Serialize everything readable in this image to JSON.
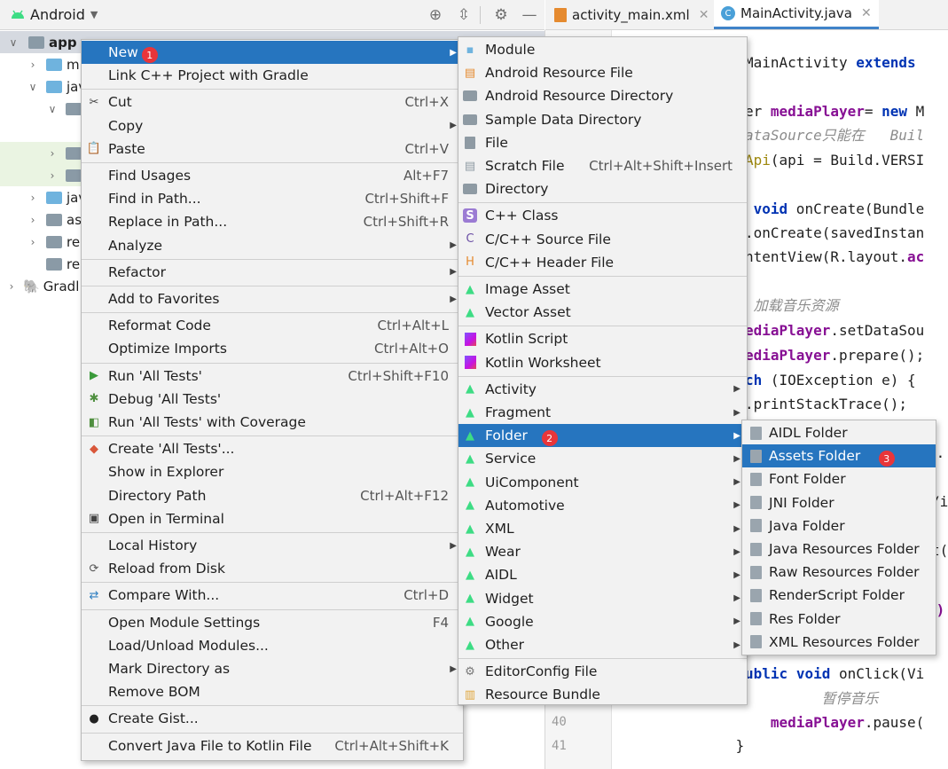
{
  "project_panel": {
    "view_selector": "Android",
    "tree": [
      {
        "label": "app",
        "expanded": true,
        "selected": true
      },
      {
        "label": "m"
      },
      {
        "label": "jav",
        "expanded": true
      },
      {
        "label": ""
      },
      {
        "label": ""
      },
      {
        "label": ""
      },
      {
        "label": "jav"
      },
      {
        "label": "as"
      },
      {
        "label": "re"
      },
      {
        "label": "re"
      },
      {
        "label": "Gradl"
      }
    ]
  },
  "editor": {
    "tabs": [
      {
        "label": "activity_main.xml",
        "active": false
      },
      {
        "label": "MainActivity.java",
        "active": true
      }
    ],
    "line_numbers": [
      "40",
      "41"
    ],
    "code_lines": [
      {
        "parts": [
          {
            "t": "MainActivity ",
            "c": ""
          },
          {
            "t": "extends",
            "c": "kw"
          }
        ]
      },
      {
        "parts": [
          {
            "t": "er ",
            "c": ""
          },
          {
            "t": "mediaPlayer",
            "c": "fld"
          },
          {
            "t": "= ",
            "c": ""
          },
          {
            "t": "new",
            "c": "kw"
          },
          {
            "t": " M",
            "c": ""
          }
        ]
      },
      {
        "parts": [
          {
            "t": "ataSource只能在   Buil",
            "c": "cm"
          }
        ]
      },
      {
        "parts": [
          {
            "t": "Api",
            "c": "ann"
          },
          {
            "t": "(api = Build.VERSI",
            "c": ""
          }
        ]
      },
      {
        "parts": [
          {
            "t": " void",
            "c": "kw"
          },
          {
            "t": " onCreate(Bundle",
            "c": ""
          }
        ]
      },
      {
        "parts": [
          {
            "t": ".onCreate(savedInstan",
            "c": ""
          }
        ]
      },
      {
        "parts": [
          {
            "t": "ntentView(R.layout.",
            "c": ""
          },
          {
            "t": "ac",
            "c": "fld"
          }
        ]
      },
      {
        "parts": [
          {
            "t": " 加载音乐资源",
            "c": "cm"
          }
        ]
      },
      {
        "parts": [
          {
            "t": "ediaPlayer",
            "c": "fld"
          },
          {
            "t": ".setDataSou",
            "c": ""
          }
        ]
      },
      {
        "parts": [
          {
            "t": "ediaPlayer",
            "c": "fld"
          },
          {
            "t": ".prepare();",
            "c": ""
          }
        ]
      },
      {
        "parts": [
          {
            "t": "ch",
            "c": "kw"
          },
          {
            "t": " (IOException e) {",
            "c": ""
          }
        ]
      },
      {
        "parts": [
          {
            "t": ".printStackTrace();",
            "c": ""
          }
        ]
      },
      {
        "parts": [
          {
            "t": ").",
            "c": ""
          }
        ]
      },
      {
        "parts": [
          {
            "t": "/i",
            "c": ""
          }
        ]
      },
      {
        "parts": [
          {
            "t": "t(",
            "c": ""
          }
        ]
      },
      {
        "parts": [
          {
            "t": "2)",
            "c": "fld"
          }
        ]
      },
      {
        "parts": [
          {
            "t": "ublic",
            "c": "kw"
          },
          {
            "t": " ",
            "c": ""
          },
          {
            "t": "void",
            "c": "kw"
          },
          {
            "t": " onClick(Vi",
            "c": ""
          }
        ]
      },
      {
        "parts": [
          {
            "t": "    暂停音乐",
            "c": "cm"
          }
        ]
      },
      {
        "parts": [
          {
            "t": "   ",
            "c": ""
          },
          {
            "t": "mediaPlayer",
            "c": "fld"
          },
          {
            "t": ".pause(",
            "c": ""
          }
        ]
      },
      {
        "parts": [
          {
            "t": " }",
            "c": ""
          }
        ]
      }
    ]
  },
  "context_menu": {
    "items": [
      {
        "label": "New",
        "submenu": true,
        "highlighted": true,
        "badge": "1"
      },
      {
        "label": "Link C++ Project with Gradle"
      },
      {
        "sep": true
      },
      {
        "label": "Cut",
        "shortcut": "Ctrl+X",
        "icon": "scissors-icon"
      },
      {
        "label": "Copy",
        "submenu": true
      },
      {
        "label": "Paste",
        "shortcut": "Ctrl+V",
        "icon": "clipboard-icon"
      },
      {
        "sep": true
      },
      {
        "label": "Find Usages",
        "shortcut": "Alt+F7"
      },
      {
        "label": "Find in Path...",
        "shortcut": "Ctrl+Shift+F"
      },
      {
        "label": "Replace in Path...",
        "shortcut": "Ctrl+Shift+R"
      },
      {
        "label": "Analyze",
        "submenu": true
      },
      {
        "sep": true
      },
      {
        "label": "Refactor",
        "submenu": true
      },
      {
        "sep": true
      },
      {
        "label": "Add to Favorites",
        "submenu": true
      },
      {
        "sep": true
      },
      {
        "label": "Reformat Code",
        "shortcut": "Ctrl+Alt+L"
      },
      {
        "label": "Optimize Imports",
        "shortcut": "Ctrl+Alt+O"
      },
      {
        "sep": true
      },
      {
        "label": "Run 'All Tests'",
        "shortcut": "Ctrl+Shift+F10",
        "icon": "run-icon"
      },
      {
        "label": "Debug 'All Tests'",
        "icon": "debug-icon"
      },
      {
        "label": "Run 'All Tests' with Coverage",
        "icon": "coverage-icon"
      },
      {
        "sep": true
      },
      {
        "label": "Create 'All Tests'...",
        "icon": "create-test-icon"
      },
      {
        "label": "Show in Explorer"
      },
      {
        "label": "Directory Path",
        "shortcut": "Ctrl+Alt+F12"
      },
      {
        "label": "Open in Terminal",
        "icon": "terminal-icon"
      },
      {
        "sep": true
      },
      {
        "label": "Local History",
        "submenu": true
      },
      {
        "label": "Reload from Disk",
        "icon": "reload-icon"
      },
      {
        "sep": true
      },
      {
        "label": "Compare With...",
        "shortcut": "Ctrl+D",
        "icon": "compare-icon"
      },
      {
        "sep": true
      },
      {
        "label": "Open Module Settings",
        "shortcut": "F4"
      },
      {
        "label": "Load/Unload Modules..."
      },
      {
        "label": "Mark Directory as",
        "submenu": true
      },
      {
        "label": "Remove BOM"
      },
      {
        "sep": true
      },
      {
        "label": "Create Gist...",
        "icon": "github-icon"
      },
      {
        "sep": true
      },
      {
        "label": "Convert Java File to Kotlin File",
        "shortcut": "Ctrl+Alt+Shift+K"
      }
    ]
  },
  "new_submenu": {
    "items": [
      {
        "label": "Module",
        "icon": "module-icon"
      },
      {
        "label": "Android Resource File",
        "icon": "resource-file-icon"
      },
      {
        "label": "Android Resource Directory",
        "icon": "folder-icon"
      },
      {
        "label": "Sample Data Directory",
        "icon": "folder-icon"
      },
      {
        "label": "File",
        "icon": "file-icon"
      },
      {
        "label": "Scratch File",
        "shortcut": "Ctrl+Alt+Shift+Insert",
        "icon": "scratch-file-icon"
      },
      {
        "label": "Directory",
        "icon": "folder-icon"
      },
      {
        "sep": true
      },
      {
        "label": "C++ Class",
        "icon": "cpp-class-icon"
      },
      {
        "label": "C/C++ Source File",
        "icon": "cpp-source-icon"
      },
      {
        "label": "C/C++ Header File",
        "icon": "cpp-header-icon"
      },
      {
        "sep": true
      },
      {
        "label": "Image Asset",
        "icon": "android-icon"
      },
      {
        "label": "Vector Asset",
        "icon": "android-icon"
      },
      {
        "sep": true
      },
      {
        "label": "Kotlin Script",
        "icon": "kotlin-icon"
      },
      {
        "label": "Kotlin Worksheet",
        "icon": "kotlin-icon"
      },
      {
        "sep": true
      },
      {
        "label": "Activity",
        "submenu": true,
        "icon": "android-icon"
      },
      {
        "label": "Fragment",
        "submenu": true,
        "icon": "android-icon"
      },
      {
        "label": "Folder",
        "submenu": true,
        "highlighted": true,
        "badge": "2",
        "icon": "android-icon"
      },
      {
        "label": "Service",
        "submenu": true,
        "icon": "android-icon"
      },
      {
        "label": "UiComponent",
        "submenu": true,
        "icon": "android-icon"
      },
      {
        "label": "Automotive",
        "submenu": true,
        "icon": "android-icon"
      },
      {
        "label": "XML",
        "submenu": true,
        "icon": "android-icon"
      },
      {
        "label": "Wear",
        "submenu": true,
        "icon": "android-icon"
      },
      {
        "label": "AIDL",
        "submenu": true,
        "icon": "android-icon"
      },
      {
        "label": "Widget",
        "submenu": true,
        "icon": "android-icon"
      },
      {
        "label": "Google",
        "submenu": true,
        "icon": "android-icon"
      },
      {
        "label": "Other",
        "submenu": true,
        "icon": "android-icon"
      },
      {
        "sep": true
      },
      {
        "label": "EditorConfig File",
        "icon": "gear-icon"
      },
      {
        "label": "Resource Bundle",
        "icon": "resource-bundle-icon"
      }
    ]
  },
  "folder_submenu": {
    "items": [
      {
        "label": "AIDL Folder"
      },
      {
        "label": "Assets Folder",
        "highlighted": true,
        "badge": "3"
      },
      {
        "label": "Font Folder"
      },
      {
        "label": "JNI Folder"
      },
      {
        "label": "Java Folder"
      },
      {
        "label": "Java Resources Folder"
      },
      {
        "label": "Raw Resources Folder"
      },
      {
        "label": "RenderScript Folder"
      },
      {
        "label": "Res Folder"
      },
      {
        "label": "XML Resources Folder"
      }
    ]
  }
}
